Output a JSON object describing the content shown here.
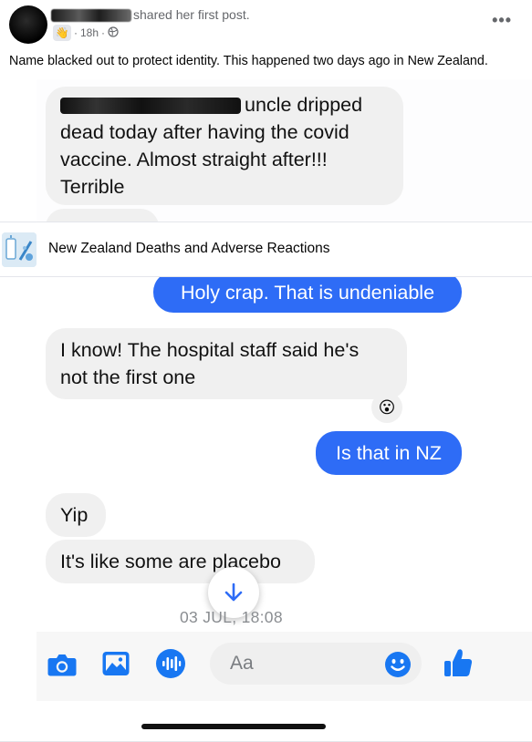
{
  "post": {
    "author_suffix": "shared her first post.",
    "time": "18h",
    "meta_separator": "·",
    "more_label": "•••",
    "caption": "Name blacked out to protect identity. This happened two days ago in New Zealand."
  },
  "group": {
    "name": "New Zealand Deaths and Adverse Reactions"
  },
  "chat": {
    "message_1_lines": [
      "uncle dripped",
      "dead today after having the covid",
      "vaccine. Almost straight after!!!",
      "Terrible"
    ],
    "message_2": "Holy crap. That is undeniable",
    "message_3_lines": [
      "I know! The hospital staff said he's",
      "not the first one"
    ],
    "reaction_emoji": "😮",
    "message_4": "Is that in NZ",
    "message_5": "Yip",
    "message_6": "It's like some are placebo",
    "timestamp": "03 JUL, 18:08",
    "composer_placeholder": "Aa"
  },
  "colors": {
    "messenger_blue": "#2e6cf6",
    "incoming_bubble": "#f0f0f0",
    "icon_blue": "#1877f2"
  },
  "icons": [
    "globe-icon",
    "camera-icon",
    "gallery-icon",
    "voice-icon",
    "emoji-icon",
    "thumbs-up-icon",
    "arrow-down-icon"
  ]
}
